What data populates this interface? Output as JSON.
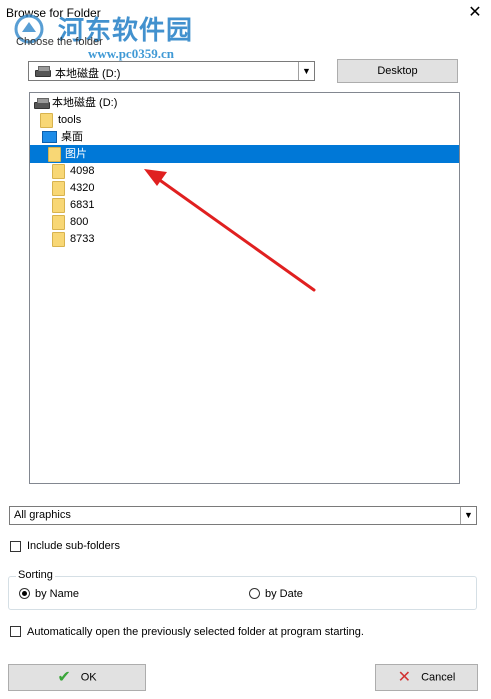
{
  "window": {
    "title": "Browse for Folder",
    "close_glyph": "✕"
  },
  "watermark": {
    "title": "河东软件园",
    "url": "www.pc0359.cn"
  },
  "choose_label": "Choose the folder",
  "drive_combo": {
    "value": "本地磁盘 (D:)",
    "arrow": "▼"
  },
  "desktop_button": "Desktop",
  "tree": {
    "root": "本地磁盘 (D:)",
    "tools": "tools",
    "desktop": "桌面",
    "selected": "图片",
    "children": [
      "4098",
      "4320",
      "6831",
      "800",
      "8733"
    ]
  },
  "filter_combo": {
    "value": "All graphics",
    "arrow": "▼"
  },
  "include_subfolders": {
    "label": "Include sub-folders",
    "checked": false
  },
  "sorting": {
    "legend": "Sorting",
    "by_name": "by Name",
    "by_date": "by Date",
    "selected": "by Name"
  },
  "auto_open": {
    "label": "Automatically open the previously selected folder at program starting.",
    "checked": false
  },
  "ok_button": {
    "label": "OK",
    "icon": "check-icon"
  },
  "cancel_button": {
    "label": "Cancel",
    "icon": "x-icon"
  },
  "colors": {
    "selection": "#0078d7",
    "arrow": "#e02020",
    "ok_check": "#3aa63a",
    "cancel_x": "#d23232"
  }
}
